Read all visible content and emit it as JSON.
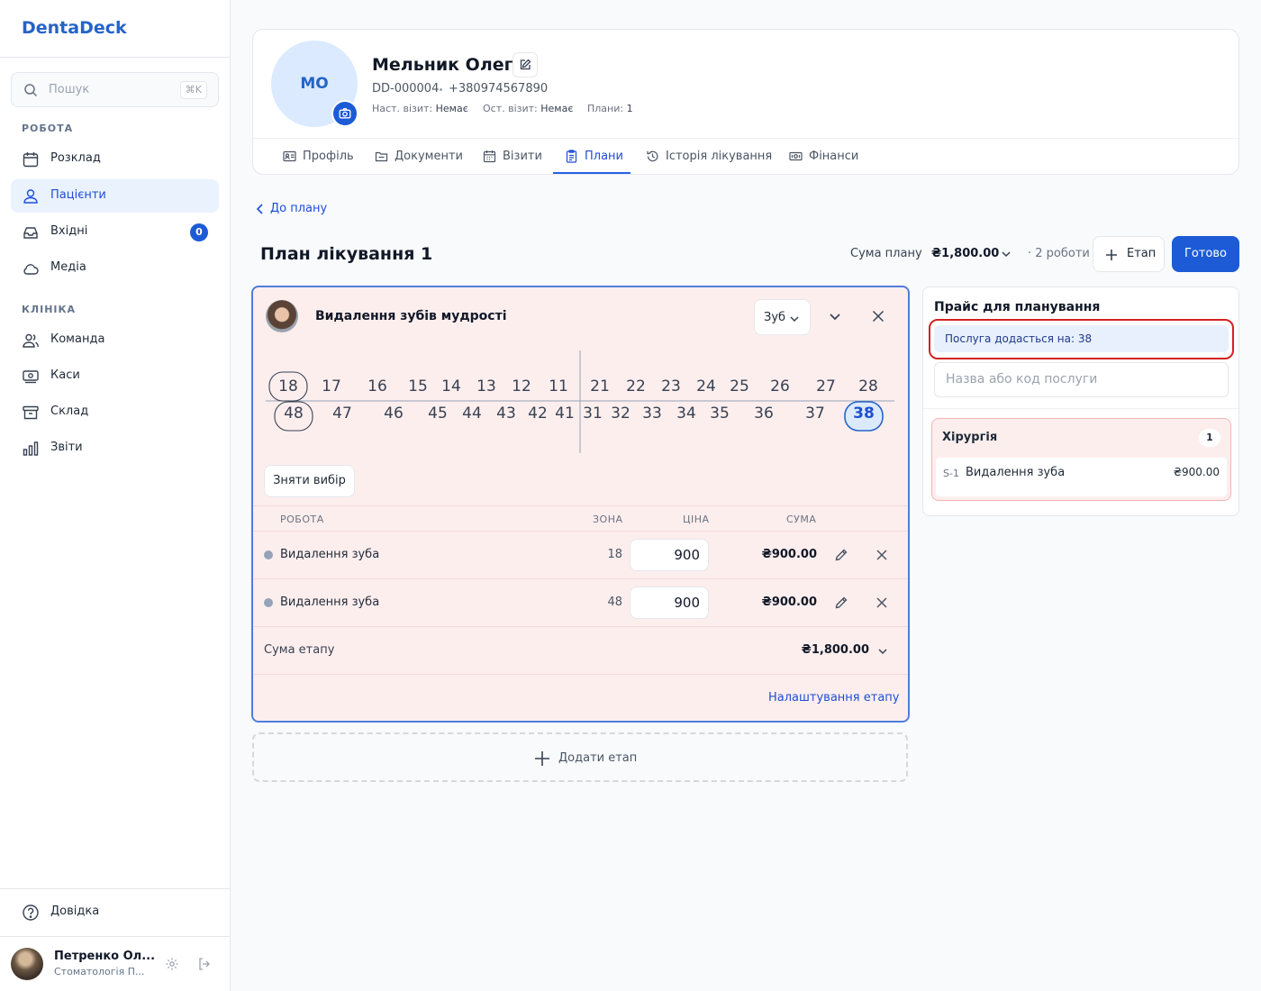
{
  "app": {
    "brand": "DentaDeck"
  },
  "sidebar": {
    "search": {
      "placeholder": "Пошук",
      "shortcut": "⌘K"
    },
    "sections": [
      {
        "label": "РОБОТА"
      },
      {
        "label": "КЛІНІКА"
      }
    ],
    "items": [
      {
        "label": "Розклад",
        "icon": "calendar-icon"
      },
      {
        "label": "Пацієнти",
        "icon": "patients-icon",
        "active": true
      },
      {
        "label": "Вхідні",
        "icon": "inbox-icon",
        "badge": "0"
      },
      {
        "label": "Медіа",
        "icon": "cloud-icon"
      },
      {
        "label": "Команда",
        "icon": "team-icon"
      },
      {
        "label": "Каси",
        "icon": "cashbox-icon"
      },
      {
        "label": "Склад",
        "icon": "warehouse-icon"
      },
      {
        "label": "Звіти",
        "icon": "reports-icon"
      }
    ],
    "help": "Довідка",
    "user": {
      "name": "Петренко Ол...",
      "role": "Стоматологія П..."
    }
  },
  "patient": {
    "initials": "МО",
    "name": "Мельник Олег",
    "id": "DD-000004",
    "phone": "+380974567890",
    "next_visit_label": "Наст. візит:",
    "next_visit": "Немає",
    "last_visit_label": "Ост. візит:",
    "last_visit": "Немає",
    "plans_label": "Плани:",
    "plans": "1"
  },
  "tabs": [
    {
      "label": "Профіль",
      "icon": "profile-card-icon"
    },
    {
      "label": "Документи",
      "icon": "folder-icon"
    },
    {
      "label": "Візити",
      "icon": "calendar-icon"
    },
    {
      "label": "Плани",
      "icon": "clipboard-icon",
      "active": true
    },
    {
      "label": "Історія лікування",
      "icon": "history-icon"
    },
    {
      "label": "Фінанси",
      "icon": "money-icon"
    }
  ],
  "plan": {
    "back_label": "До плану",
    "title": "План лікування 1",
    "sum_label": "Сума плану",
    "sum_value": "₴1,800.00",
    "works": "· 2 роботи",
    "add_stage_btn": "Етап",
    "done_btn": "Готово"
  },
  "stage": {
    "title": "Видалення зубів мудрості",
    "zone_select": "Зуб",
    "teeth_upper": [
      "18",
      "17",
      "16",
      "15",
      "14",
      "13",
      "12",
      "11",
      "21",
      "22",
      "23",
      "24",
      "25",
      "26",
      "27",
      "28"
    ],
    "teeth_lower": [
      "48",
      "47",
      "46",
      "45",
      "44",
      "43",
      "42",
      "41",
      "31",
      "32",
      "33",
      "34",
      "35",
      "36",
      "37",
      "38"
    ],
    "marked_teeth": [
      "18",
      "48"
    ],
    "selected_tooth": "38",
    "clear_btn": "Зняти вибір",
    "columns": {
      "work": "РОБОТА",
      "zone": "ЗОНА",
      "price": "ЦІНА",
      "sum": "СУМА"
    },
    "rows": [
      {
        "work": "Видалення зуба",
        "zone": "18",
        "price": "900",
        "sum": "₴900.00"
      },
      {
        "work": "Видалення зуба",
        "zone": "48",
        "price": "900",
        "sum": "₴900.00"
      }
    ],
    "stage_sum_label": "Сума етапу",
    "stage_sum": "₴1,800.00",
    "settings_link": "Налаштування етапу"
  },
  "add_stage": "Додати етап",
  "price_panel": {
    "title": "Прайс для планування",
    "hint": "Послуга додасться на: 38",
    "search_placeholder": "Назва або код послуги",
    "category": {
      "name": "Хірургія",
      "count": "1"
    },
    "items": [
      {
        "code": "S-1",
        "name": "Видалення зуба",
        "price": "₴900.00"
      }
    ]
  },
  "colors": {
    "accent": "#1d5bd6",
    "stage_bg": "#fdeeee",
    "stage_border": "#4f7ddb",
    "highlight_ring": "#d32222"
  }
}
